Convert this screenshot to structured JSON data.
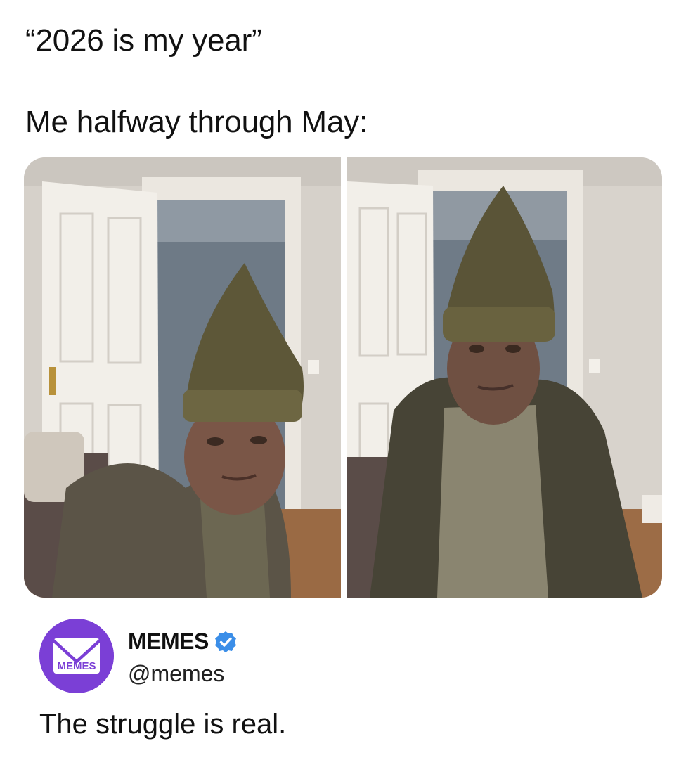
{
  "captions": {
    "line1": "“2026 is my year”",
    "line2": "Me halfway through May:"
  },
  "images": {
    "left": {
      "name": "photo-before"
    },
    "right": {
      "name": "photo-after"
    }
  },
  "account": {
    "avatar_text": "MEMES",
    "display_name": "MEMES",
    "handle": "@memes",
    "verified": true,
    "badge_icon": "verified-check-icon",
    "avatar_color": "#7b3fd6",
    "badge_color": "#3b8ee8"
  },
  "tweet_text": "The struggle is real."
}
